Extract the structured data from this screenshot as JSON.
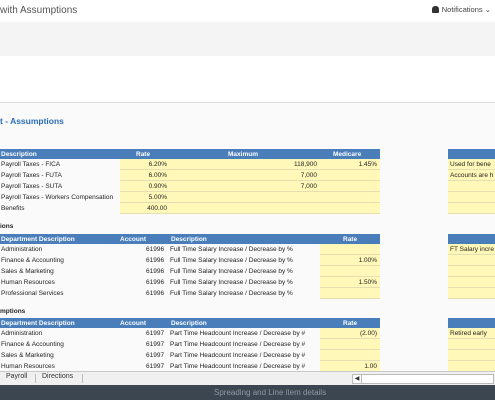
{
  "header": {
    "title": "with Assumptions",
    "notifications": "Notifications"
  },
  "sheet_title": "t - Assumptions",
  "table1": {
    "columns": [
      "Description",
      "Rate",
      "Maximum",
      "Medicare"
    ],
    "rows": [
      {
        "desc": "Payroll Taxes - FICA",
        "rate": "6.20%",
        "max": "118,900",
        "medicare": "1.45%"
      },
      {
        "desc": "Payroll Taxes - FUTA",
        "rate": "6.00%",
        "max": "7,000",
        "medicare": ""
      },
      {
        "desc": "Payroll Taxes - SUTA",
        "rate": "0.90%",
        "max": "7,000",
        "medicare": ""
      },
      {
        "desc": "Payroll Taxes - Workers Compensation",
        "rate": "5.00%",
        "max": "",
        "medicare": ""
      },
      {
        "desc": "Benefits",
        "rate": "400.00",
        "max": "",
        "medicare": ""
      }
    ],
    "side_notes": [
      "Used for bene",
      "Accounts are h",
      "",
      "",
      ""
    ]
  },
  "section2": {
    "label": "ions"
  },
  "table2": {
    "columns": [
      "Department Description",
      "Account",
      "Description",
      "Rate"
    ],
    "rows": [
      {
        "dept": "Administration",
        "acct": "61996",
        "desc": "Full Time Salary Increase / Decrease by %",
        "rate": ""
      },
      {
        "dept": "Finance & Accounting",
        "acct": "61996",
        "desc": "Full Time Salary Increase / Decrease by %",
        "rate": "1.00%"
      },
      {
        "dept": "Sales & Marketing",
        "acct": "61996",
        "desc": "Full Time Salary Increase / Decrease by %",
        "rate": ""
      },
      {
        "dept": "Human Resources",
        "acct": "61996",
        "desc": "Full Time Salary Increase / Decrease by %",
        "rate": "1.50%"
      },
      {
        "dept": "Professional Services",
        "acct": "61996",
        "desc": "Full Time Salary Increase / Decrease by %",
        "rate": ""
      }
    ],
    "side_notes": [
      "FT Salary incre",
      "",
      "",
      "",
      ""
    ]
  },
  "section3": {
    "label": "mptions"
  },
  "table3": {
    "columns": [
      "Department Description",
      "Account",
      "Description",
      "Rate"
    ],
    "rows": [
      {
        "dept": "Administration",
        "acct": "61997",
        "desc": "Part Time Headcount Increase / Decrease by #",
        "rate": "(2.00)"
      },
      {
        "dept": "Finance & Accounting",
        "acct": "61997",
        "desc": "Part Time Headcount Increase / Decrease by #",
        "rate": ""
      },
      {
        "dept": "Sales & Marketing",
        "acct": "61997",
        "desc": "Part Time Headcount Increase / Decrease by #",
        "rate": ""
      },
      {
        "dept": "Human Resources",
        "acct": "61997",
        "desc": "Part Time Headcount Increase / Decrease by #",
        "rate": "1.00"
      }
    ],
    "side_notes": [
      "Retired early",
      "",
      "",
      ""
    ]
  },
  "tabs": [
    "Payroll",
    "Directions"
  ],
  "footer": {
    "label": "Spreading and Line item details"
  }
}
